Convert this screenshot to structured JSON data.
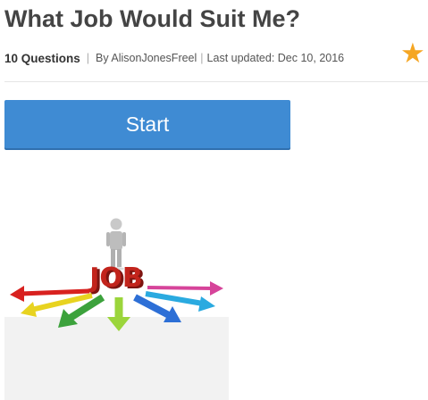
{
  "quiz": {
    "title": "What Job Would Suit Me?",
    "question_count": "10 Questions",
    "separator": "|",
    "author": "By AlisonJonesFreel",
    "last_updated": "Last updated: Dec 10, 2016",
    "favorite_icon": "star-icon",
    "start_label": "Start",
    "image": {
      "word": "JOB",
      "icons": [
        "person-figure",
        "arrow-icon"
      ]
    }
  },
  "colors": {
    "title": "#444444",
    "button": "#3f8bd3",
    "star": "#f5a623",
    "job_text": "#c2241c",
    "arrows": [
      "#d8211f",
      "#e8d320",
      "#3ca23c",
      "#9bd53b",
      "#2d6fd6",
      "#2aaae0",
      "#d6449a"
    ]
  }
}
